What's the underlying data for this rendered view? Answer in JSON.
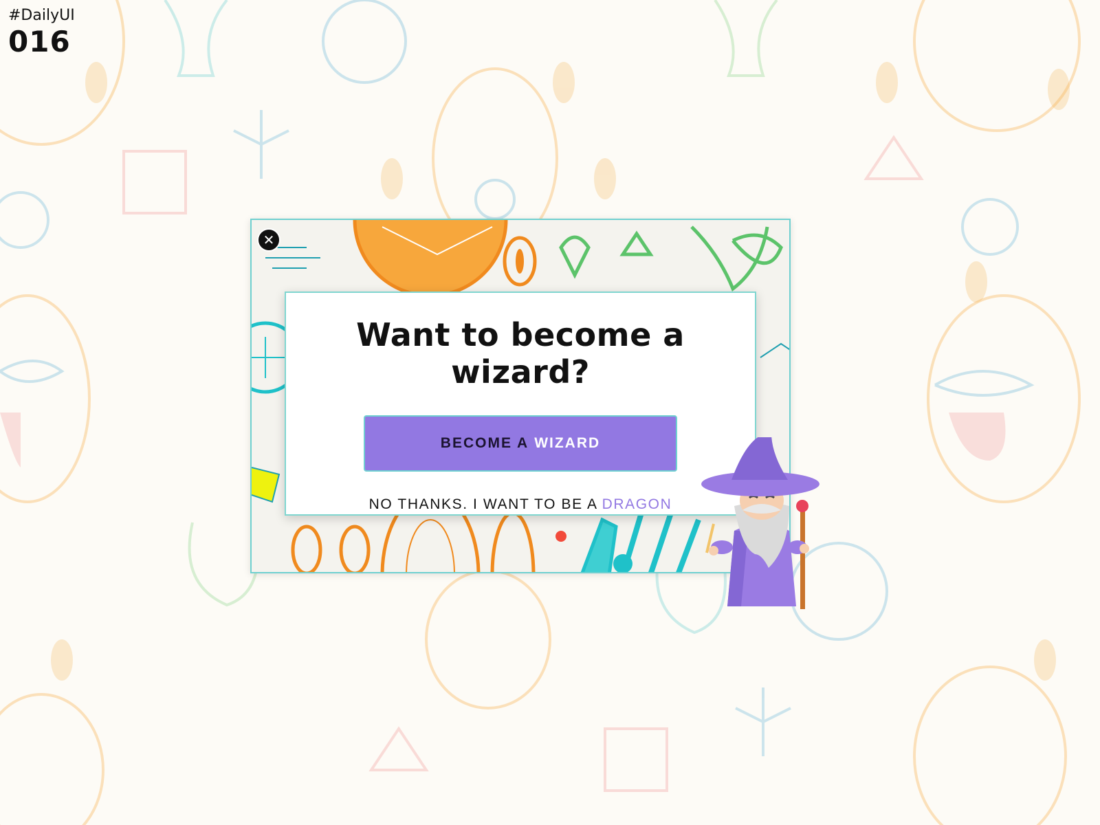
{
  "badge": {
    "tag": "#DailyUI",
    "number": "016"
  },
  "modal": {
    "title": "Want to become a wizard?",
    "cta": {
      "prefix": "BECOME A",
      "highlight": "WIZARD"
    },
    "decline": {
      "prefix": "NO THANKS. I WANT TO BE A",
      "highlight": "DRAGON"
    }
  },
  "colors": {
    "accent": "#9278e2",
    "frame_border": "#6fd0d0",
    "background": "#fdfbf6"
  },
  "icons": {
    "close": "close-icon",
    "mascot": "wizard-illustration"
  }
}
